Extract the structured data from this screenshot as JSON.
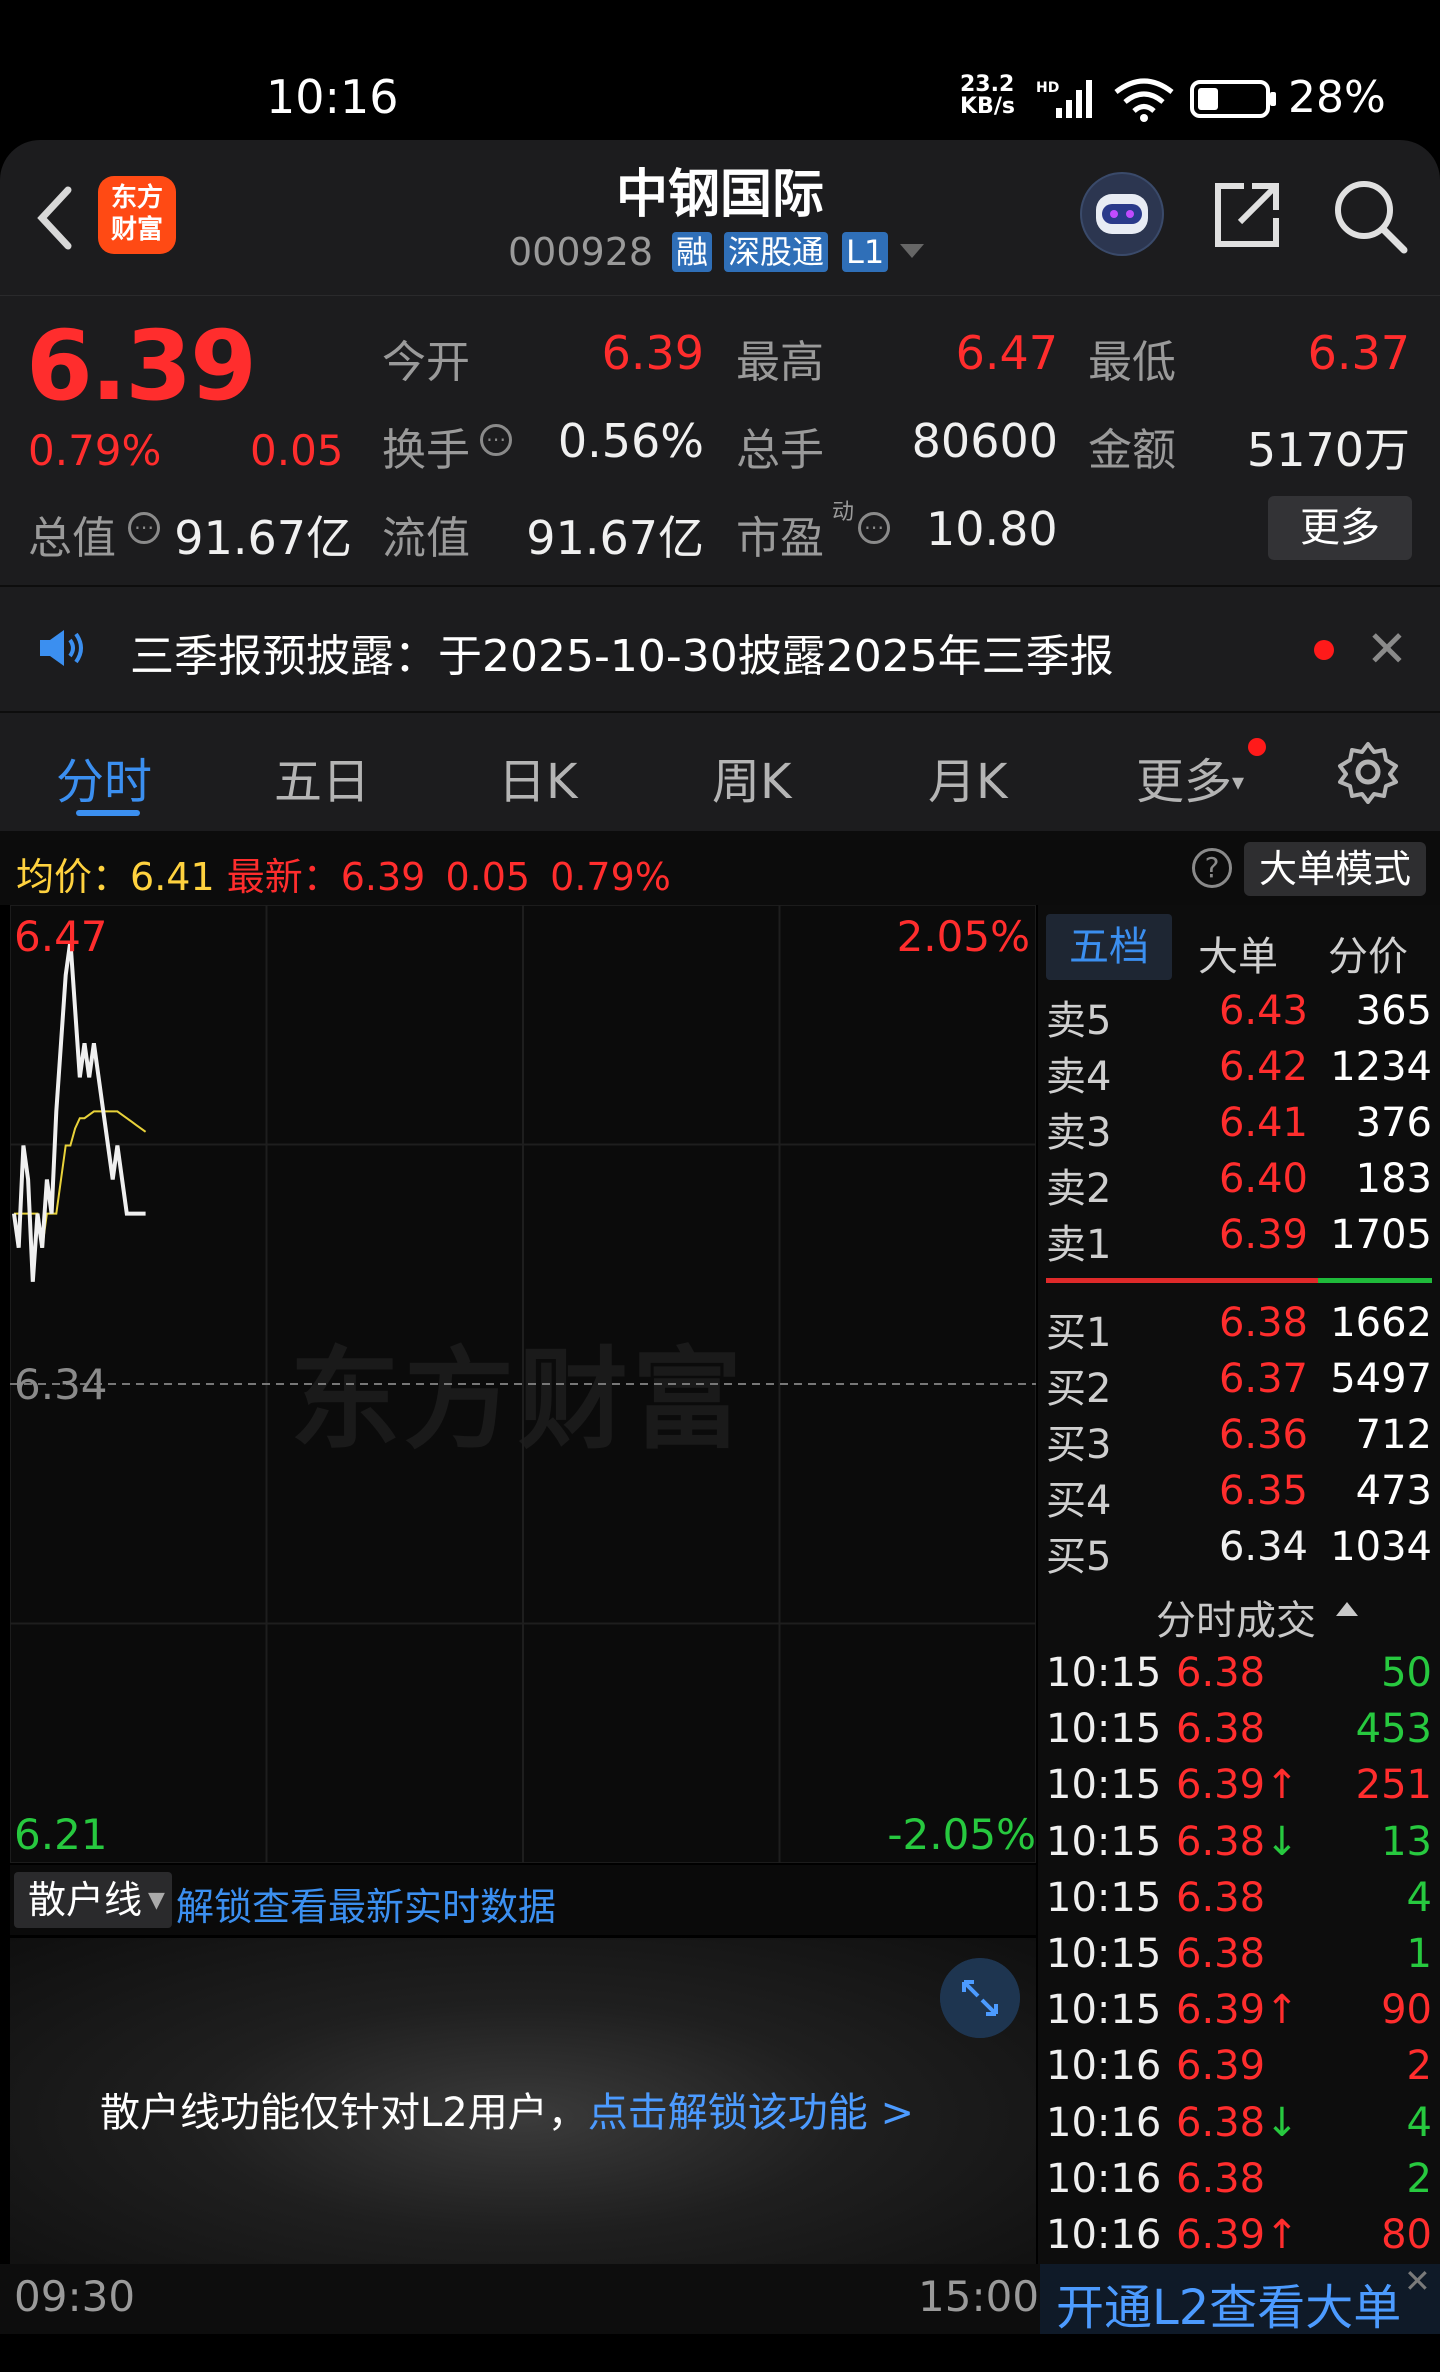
{
  "status_bar": {
    "time": "10:16",
    "net_speed_top": "23.2",
    "net_speed_unit": "KB/s",
    "hd": "HD",
    "battery_pct": "28%"
  },
  "header": {
    "app_logo": "东方财富",
    "stock_name": "中钢国际",
    "stock_code": "000928",
    "tags": [
      "融",
      "深股通",
      "L1"
    ]
  },
  "quote": {
    "price": "6.39",
    "change_pct": "0.79%",
    "change_abs": "0.05",
    "fields": {
      "open_label": "今开",
      "open": "6.39",
      "high_label": "最高",
      "high": "6.47",
      "low_label": "最低",
      "low": "6.37",
      "turnover_label": "换手",
      "turnover": "0.56%",
      "volume_label": "总手",
      "volume": "80600",
      "amount_label": "金额",
      "amount": "5170万",
      "mktcap_label": "总值",
      "mktcap": "91.67亿",
      "float_label": "流值",
      "float": "91.67亿",
      "pe_label": "市盈",
      "pe_sup": "动",
      "pe": "10.80"
    },
    "more_label": "更多"
  },
  "notice": {
    "text": "三季报预披露：于2025-10-30披露2025年三季报"
  },
  "tabs": [
    "分时",
    "五日",
    "日K",
    "周K",
    "月K",
    "更多"
  ],
  "info": {
    "avg_label": "均价：",
    "avg": "6.41",
    "latest_label": "最新：",
    "latest": "6.39",
    "chg": "0.05",
    "chg_pct": "0.79%",
    "mode_label": "大单模式",
    "help": "?"
  },
  "chart_data": {
    "type": "line",
    "title": "",
    "y_axis_left": {
      "top": "6.47",
      "mid": "6.34",
      "bottom": "6.21"
    },
    "y_axis_right": {
      "top": "2.05%",
      "bottom": "-2.05%"
    },
    "ylim": [
      6.21,
      6.47
    ],
    "x_labels": {
      "start": "09:30",
      "end": "15:00"
    },
    "watermark": "东方财富",
    "series": [
      {
        "name": "price",
        "color": "#f0f0f0",
        "values": [
          6.39,
          6.38,
          6.41,
          6.4,
          6.37,
          6.39,
          6.38,
          6.4,
          6.39,
          6.42,
          6.44,
          6.46,
          6.47,
          6.45,
          6.43,
          6.44,
          6.43,
          6.44,
          6.43,
          6.42,
          6.41,
          6.4,
          6.41,
          6.4,
          6.39,
          6.39,
          6.39,
          6.39,
          6.39
        ]
      },
      {
        "name": "avg",
        "color": "#e8d23a",
        "values": [
          6.39,
          6.39,
          6.39,
          6.39,
          6.39,
          6.39,
          6.38,
          6.39,
          6.39,
          6.39,
          6.4,
          6.41,
          6.41,
          6.415,
          6.418,
          6.418,
          6.419,
          6.42,
          6.42,
          6.42,
          6.42,
          6.42,
          6.42,
          6.419,
          6.418,
          6.417,
          6.416,
          6.415,
          6.414
        ]
      }
    ]
  },
  "order_book": {
    "tabs": [
      "五档",
      "大单",
      "分价"
    ],
    "asks": [
      {
        "label": "卖5",
        "price": "6.43",
        "vol": "365"
      },
      {
        "label": "卖4",
        "price": "6.42",
        "vol": "1234"
      },
      {
        "label": "卖3",
        "price": "6.41",
        "vol": "376"
      },
      {
        "label": "卖2",
        "price": "6.40",
        "vol": "183"
      },
      {
        "label": "卖1",
        "price": "6.39",
        "vol": "1705"
      }
    ],
    "bids": [
      {
        "label": "买1",
        "price": "6.38",
        "vol": "1662",
        "color": "#ff2d2d"
      },
      {
        "label": "买2",
        "price": "6.37",
        "vol": "5497",
        "color": "#ff2d2d"
      },
      {
        "label": "买3",
        "price": "6.36",
        "vol": "712",
        "color": "#ff2d2d"
      },
      {
        "label": "买4",
        "price": "6.35",
        "vol": "473",
        "color": "#ff2d2d"
      },
      {
        "label": "买5",
        "price": "6.34",
        "vol": "1034",
        "color": "#f0f0f0"
      }
    ],
    "trades_title": "分时成交",
    "trades": [
      {
        "time": "10:15",
        "price": "6.38",
        "arrow": "",
        "vol": "50",
        "vol_color": "#27c93f"
      },
      {
        "time": "10:15",
        "price": "6.38",
        "arrow": "",
        "vol": "453",
        "vol_color": "#27c93f"
      },
      {
        "time": "10:15",
        "price": "6.39",
        "arrow": "↑",
        "vol": "251",
        "vol_color": "#ff2d2d"
      },
      {
        "time": "10:15",
        "price": "6.38",
        "arrow": "↓",
        "vol": "13",
        "vol_color": "#27c93f"
      },
      {
        "time": "10:15",
        "price": "6.38",
        "arrow": "",
        "vol": "4",
        "vol_color": "#27c93f"
      },
      {
        "time": "10:15",
        "price": "6.38",
        "arrow": "",
        "vol": "1",
        "vol_color": "#27c93f"
      },
      {
        "time": "10:15",
        "price": "6.39",
        "arrow": "↑",
        "vol": "90",
        "vol_color": "#ff2d2d"
      },
      {
        "time": "10:16",
        "price": "6.39",
        "arrow": "",
        "vol": "2",
        "vol_color": "#ff2d2d"
      },
      {
        "time": "10:16",
        "price": "6.38",
        "arrow": "↓",
        "vol": "4",
        "vol_color": "#27c93f"
      },
      {
        "time": "10:16",
        "price": "6.38",
        "arrow": "",
        "vol": "2",
        "vol_color": "#27c93f"
      },
      {
        "time": "10:16",
        "price": "6.39",
        "arrow": "↑",
        "vol": "80",
        "vol_color": "#ff2d2d"
      }
    ]
  },
  "retail": {
    "selector_label": "散户线",
    "unlock_link": "解锁查看最新实时数据",
    "message": "散户线功能仅针对L2用户，",
    "message_link": "点击解锁该功能 >"
  },
  "l2_banner": "开通L2查看大单"
}
